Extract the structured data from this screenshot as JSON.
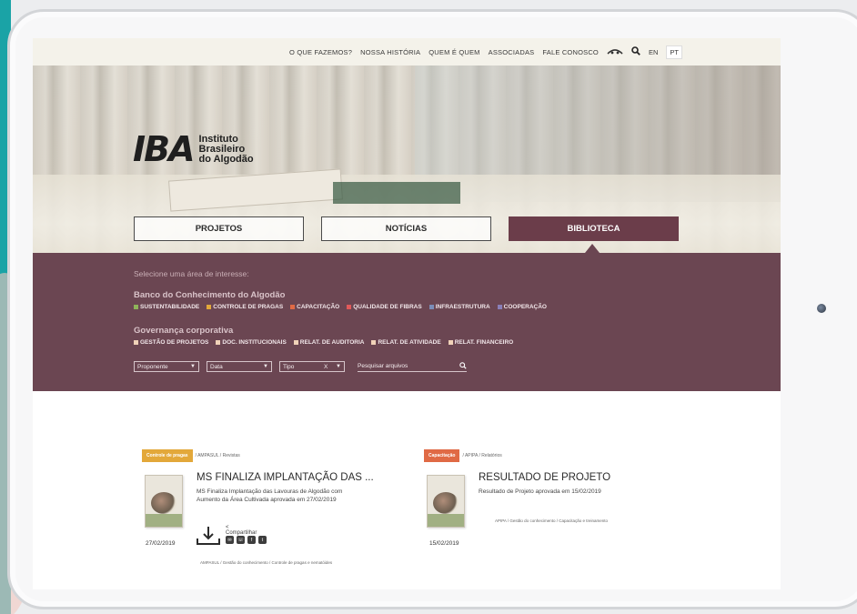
{
  "topnav": {
    "links": [
      "O QUE FAZEMOS?",
      "NOSSA HISTÓRIA",
      "QUEM É QUEM",
      "ASSOCIADAS",
      "FALE CONOSCO"
    ],
    "lang_en": "EN",
    "lang_pt": "PT"
  },
  "logo": {
    "mark": "IBA",
    "line1": "Instituto",
    "line2": "Brasileiro",
    "line3": "do Algodão"
  },
  "tabs": [
    {
      "label": "PROJETOS",
      "active": false
    },
    {
      "label": "NOTÍCIAS",
      "active": false
    },
    {
      "label": "BIBLIOTECA",
      "active": true
    }
  ],
  "filters": {
    "prompt": "Selecione uma área de interesse:",
    "section1_title": "Banco do Conhecimento do Algodão",
    "section1_chips": [
      {
        "label": "SUSTENTABILIDADE",
        "color": "#8fb35a"
      },
      {
        "label": "CONTROLE DE PRAGAS",
        "color": "#e3a83a"
      },
      {
        "label": "CAPACITAÇÃO",
        "color": "#e06a45"
      },
      {
        "label": "QUALIDADE DE FIBRAS",
        "color": "#e25a5a"
      },
      {
        "label": "INFRAESTRUTURA",
        "color": "#7b8db8"
      },
      {
        "label": "COOPERAÇÃO",
        "color": "#8a7fb8"
      }
    ],
    "section2_title": "Governança corporativa",
    "section2_chips": [
      {
        "label": "GESTÃO DE PROJETOS",
        "color": "#f0d2b8"
      },
      {
        "label": "DOC. INSTITUCIONAIS",
        "color": "#f0d2b8"
      },
      {
        "label": "RELAT. DE AUDITORIA",
        "color": "#f0d2b8"
      },
      {
        "label": "RELAT. DE ATIVIDADE",
        "color": "#f0d2b8"
      },
      {
        "label": "RELAT. FINANCEIRO",
        "color": "#f0d2b8"
      }
    ],
    "select_proponente": "Proponente",
    "select_data": "Data",
    "select_tipo": "Tipo",
    "select_tipo_clear": "X",
    "search_placeholder": "Pesquisar arquivos"
  },
  "cards": [
    {
      "badge": "Controle de pragas",
      "badge_color": "#e3a83a",
      "crumb": "/ AMPASUL / Revistas",
      "title": "MS FINALIZA IMPLANTAÇÃO DAS ...",
      "desc": "MS Finaliza Implantação das Lavouras de Algodão com Aumento da Área Cultivada aprovada em 27/02/2019",
      "date": "27/02/2019",
      "share": "Compartilhar",
      "meta": "AMPASUL / Gestão do conhecimento / Controle de pragas e nematóides"
    },
    {
      "badge": "Capacitação",
      "badge_color": "#e06a45",
      "crumb": "/ APIPA / Relatórios",
      "title": "RESULTADO DE PROJETO",
      "desc": "Resultado de Projeto aprovada em 15/02/2019",
      "date": "15/02/2019",
      "meta": "APIPA / Gestão do conhecimento / Capacitação e treinamento"
    }
  ]
}
